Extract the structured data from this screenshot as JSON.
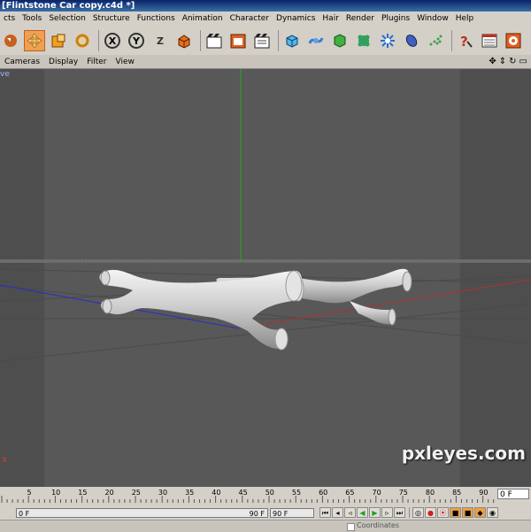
{
  "window": {
    "title": "[Flintstone Car copy.c4d *]"
  },
  "menu": [
    "cts",
    "Tools",
    "Selection",
    "Structure",
    "Functions",
    "Animation",
    "Character",
    "Dynamics",
    "Hair",
    "Render",
    "Plugins",
    "Window",
    "Help"
  ],
  "toolbar": {
    "icons": [
      "undo-icon",
      "move-icon",
      "scale-icon",
      "rotate-icon",
      "x-axis-icon",
      "y-axis-icon",
      "z-axis-icon",
      "world-coords-icon",
      "render-view-icon",
      "render-region-icon",
      "render-settings-icon",
      "cube-primitive-icon",
      "nurbs-icon",
      "deformer-icon",
      "scene-object-icon",
      "light-icon",
      "camera-icon",
      "particles-icon",
      "help-icon",
      "timeline-icon",
      "browser-icon"
    ],
    "x_label": "X",
    "y_label": "Y",
    "z_label": "Z"
  },
  "view_menu": [
    "Cameras",
    "Display",
    "Filter",
    "View"
  ],
  "viewport": {
    "label": "ve"
  },
  "timeline": {
    "ticks": [
      "5",
      "10",
      "15",
      "20",
      "25",
      "30",
      "35",
      "40",
      "45",
      "50",
      "55",
      "60",
      "65",
      "70",
      "75",
      "80",
      "85",
      "90"
    ],
    "current_frame": "0 F"
  },
  "transport": {
    "start_field": "0 F",
    "end_field": "90 F",
    "max_field": "90 F"
  },
  "bottom": {
    "coordinates_label": "Coordinates"
  },
  "watermark": "pxleyes.com"
}
